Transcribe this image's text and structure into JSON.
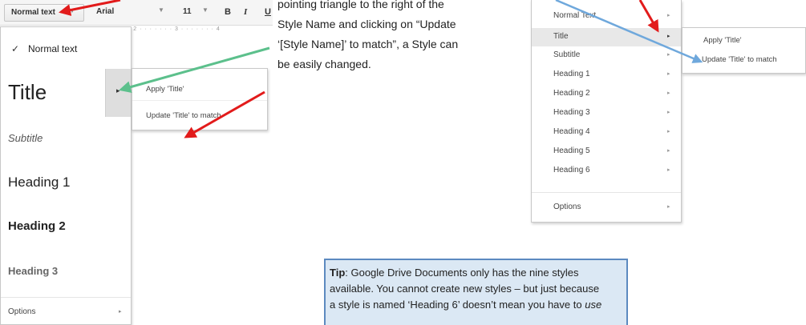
{
  "toolbar": {
    "style_select": "Normal text",
    "font_select": "Arial",
    "size_select": "11",
    "bold_label": "B",
    "italic_label": "I",
    "underline_label": "U",
    "ruler_text": "· 2 · · · · · · · 3 · · · · · · · 4"
  },
  "style_menu": {
    "normal": "Normal text",
    "title": "Title",
    "subtitle": "Subtitle",
    "heading1": "Heading 1",
    "heading2": "Heading 2",
    "heading3": "Heading 3",
    "options": "Options",
    "check_glyph": "✓",
    "arrow_glyph": "▸"
  },
  "title_submenu": {
    "apply": "Apply 'Title'",
    "update": "Update 'Title' to match"
  },
  "explanation": {
    "line1": "pointing triangle to the right of the",
    "line2": "Style Name and clicking on “Update",
    "line3": "‘[Style Name]’ to match”, a Style can",
    "line4": "be easily changed."
  },
  "right_menu": {
    "items": [
      "Normal Text",
      "Title",
      "Subtitle",
      "Heading 1",
      "Heading 2",
      "Heading 3",
      "Heading 4",
      "Heading 5",
      "Heading 6",
      "Options"
    ]
  },
  "right_submenu": {
    "apply": "Apply 'Title'",
    "update": "Update 'Title' to match"
  },
  "tip": {
    "label": "Tip",
    "line1": ": Google Drive Documents only has the nine styles",
    "line2": "available. You cannot create new styles – but just because",
    "line3_a": "a style is named ‘Heading 6’ doesn’t mean you have to ",
    "line3_b": "use"
  },
  "colors": {
    "red_arrow": "#e21b1b",
    "green_arrow": "#5cc08c",
    "blue_arrow": "#6fa8dc",
    "tip_bg": "#dbe8f4",
    "tip_border": "#5c8ac0"
  }
}
